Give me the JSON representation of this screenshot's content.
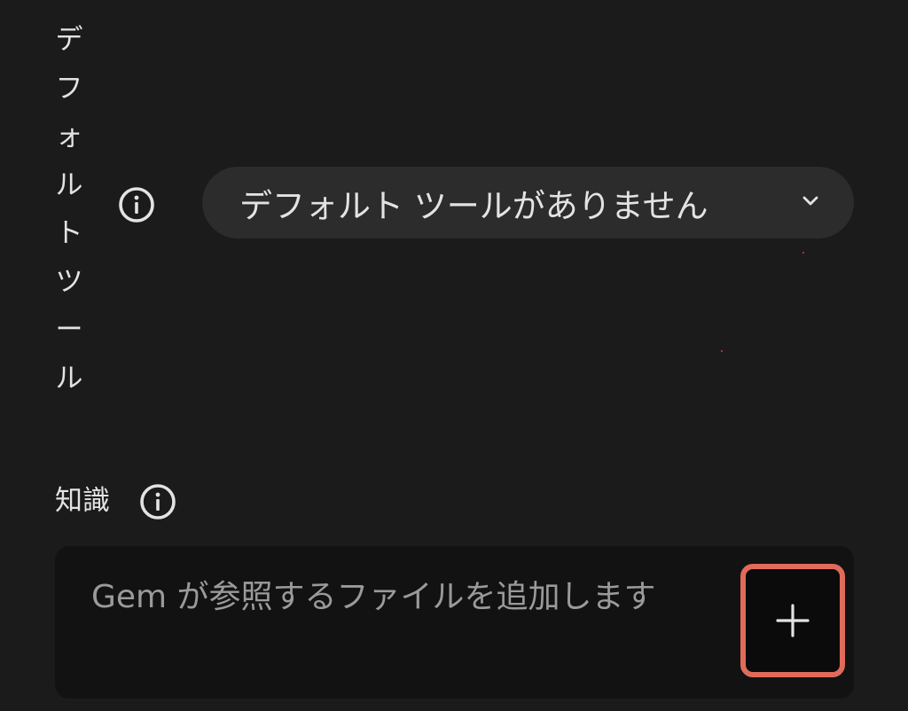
{
  "default_tools": {
    "label_chars": [
      "デ",
      "フ",
      "ォ",
      "ル",
      "ト",
      "ツ",
      "ー",
      "ル"
    ],
    "dropdown_value": "デフォルト ツールがありません",
    "info_icon": "info-icon",
    "chevron_icon": "chevron-down-icon"
  },
  "knowledge": {
    "label": "知識",
    "info_icon": "info-icon",
    "placeholder": "Gem が参照するファイルを追加します",
    "add_icon": "plus-icon"
  },
  "colors": {
    "background": "#1b1b1c",
    "dropdown_bg": "#2c2c2d",
    "knowledge_box_bg": "#121213",
    "highlight_border": "#e06b5a",
    "text": "#e3e3e3",
    "placeholder_text": "#9a9a9b"
  }
}
